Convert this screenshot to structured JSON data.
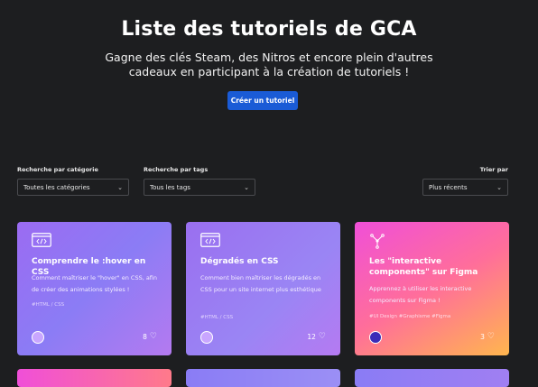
{
  "hero": {
    "title": "Liste des tutoriels de GCA",
    "subtitle_line1": "Gagne des clés Steam, des Nitros et encore plein d'autres",
    "subtitle_line2": "cadeaux en participant à la création de tutoriels !",
    "cta_label": "Créer un tutoriel"
  },
  "filters": {
    "category_label": "Recherche par catégorie",
    "category_value": "Toutes les catégories",
    "tags_label": "Recherche par tags",
    "tags_value": "Tous les tags",
    "sort_label": "Trier par",
    "sort_value": "Plus récents"
  },
  "cards": [
    {
      "title": "Comprendre le :hover en CSS",
      "description": "Comment maîtriser le \"hover\" en CSS, afin de créer des animations stylées !",
      "tags": "#HTML / CSS",
      "likes": "8",
      "icon": "code-window-icon"
    },
    {
      "title": "Dégradés en CSS",
      "description": "Comment bien maîtriser les dégradés en CSS pour un site internet plus esthétique",
      "tags": "#HTML / CSS",
      "likes": "12",
      "icon": "code-window-icon"
    },
    {
      "title": "Les \"interactive components\" sur Figma",
      "description": "Apprennez à utiliser les interactive components sur Figma !",
      "tags": "#UI Design  #Graphisme  #Figma",
      "likes": "3",
      "icon": "component-nodes-icon"
    }
  ],
  "colors": {
    "background": "#1d1e20",
    "accent": "#1a5bd6"
  }
}
